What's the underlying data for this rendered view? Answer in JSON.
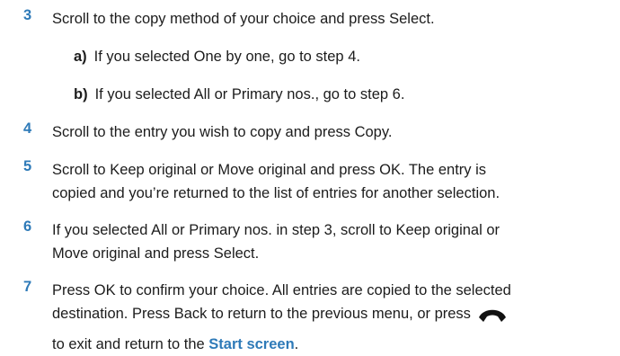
{
  "steps": [
    {
      "num": "3",
      "parts": [
        "Scroll to the copy method of your choice and press ",
        "Select",
        "."
      ]
    },
    {
      "label": "a)",
      "parts": [
        "If you selected ",
        "One by one",
        ", go to step 4."
      ]
    },
    {
      "label": "b)",
      "parts": [
        "If you selected ",
        "All",
        " or ",
        "Primary nos.",
        ", go to step 6."
      ]
    },
    {
      "num": "4",
      "parts": [
        "Scroll to the entry you wish to copy and press ",
        "Copy",
        "."
      ]
    },
    {
      "num": "5",
      "lines": [
        [
          "Scroll to ",
          "Keep original",
          " or ",
          "Move original",
          " and press ",
          "OK",
          ". The entry is"
        ],
        [
          "copied and you’re returned to the list of entries for another selection."
        ]
      ]
    },
    {
      "num": "6",
      "lines": [
        [
          "If you selected ",
          "All",
          " or ",
          "Primary nos.",
          " in step 3, scroll to ",
          "Keep original",
          " or"
        ],
        [
          "Move original",
          " and press ",
          "Select",
          "."
        ]
      ]
    },
    {
      "num": "7",
      "lines": [
        [
          "Press ",
          "OK",
          " to confirm your choice. All entries are copied to the selected"
        ],
        [
          "destination. Press ",
          "Back",
          " to return to the previous menu, or press"
        ],
        [
          "to exit and return to the ",
          "Start screen",
          "."
        ]
      ]
    }
  ],
  "icons": {
    "end_key": "end-call-handset-icon"
  },
  "colors": {
    "step_number": "#2e7ab8",
    "link": "#2e7ab8"
  }
}
